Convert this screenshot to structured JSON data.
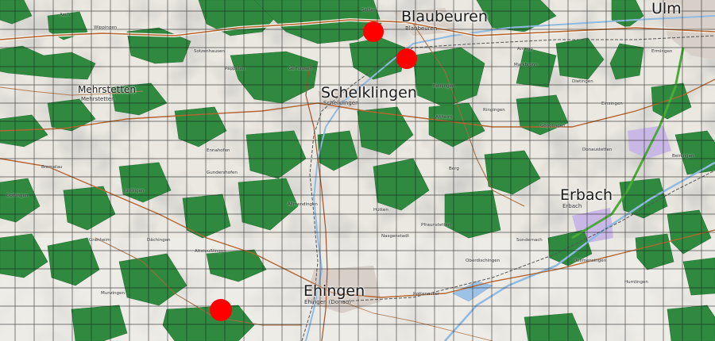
{
  "cities": {
    "ulm": "Ulm",
    "blaubeuren": "Blaubeuren",
    "blaubeuren_sub": "Blaubeuren",
    "schelklingen": "Schelklingen",
    "schelklingen_sub": "Schelklingen",
    "mehrstetten": "Mehrstetten",
    "mehrstetten_sub": "Mehrstetten",
    "erbach": "Erbach",
    "erbach_sub": "Erbach",
    "ehingen": "Ehingen",
    "ehingen_sub": "Ehingen (Donau)"
  },
  "villages": {
    "seissen": "Seißen",
    "asch": "Asch",
    "beiningen": "Beiningen",
    "ringingen": "Ringingen",
    "arnegg": "Arnegg",
    "dietingen": "Dietingen",
    "markbronn": "Markbronn",
    "ermingen": "Ermingen",
    "einsingen": "Einsingen",
    "donaustetten": "Donaustetten",
    "gogglingen": "Gögglingen",
    "dellmensingen": "Dellmensingen",
    "hummlingen": "Humlingen",
    "rottenacker": "Rottenacker",
    "allmendingen": "Allmendingen",
    "altsteusslingen": "Altsteußlingen",
    "dachingen": "Dächingen",
    "granheim": "Granheim",
    "munzingen": "Munzingen",
    "nasgenstadt": "Nasgenstadt",
    "berg": "Berg",
    "oberdischingen": "Oberdischingen",
    "pfraunstetten": "Pfraunstetten",
    "ennahofen": "Ennahofen",
    "gundershofen": "Gundershofen",
    "bremelau": "Bremelau",
    "dottingen": "Dottingen",
    "justingen": "Justingen",
    "hutten": "Hütten",
    "sondernach": "Sondernach",
    "wippingen": "Wippingen",
    "sotzenhausen": "Sotzenhausen",
    "pappelau": "Pappelau",
    "beiningen2": "Beiningen",
    "altheim": "Altheim",
    "gerhausen": "Gerhausen"
  },
  "markers": {
    "color": "#ff0000",
    "count": 3
  },
  "colors": {
    "forest": "#2f8a40",
    "field": "#ebe8e1",
    "grid": "#1a1a1a",
    "road_main": "#a0522d",
    "river": "#9cc3e6"
  }
}
